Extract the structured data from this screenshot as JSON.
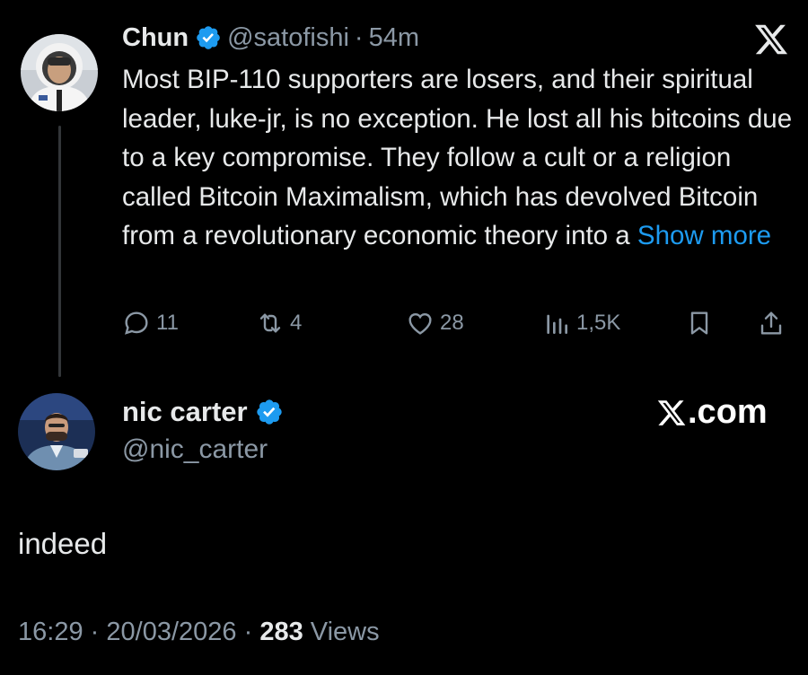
{
  "quoted_tweet": {
    "display_name": "Chun",
    "handle": "@satofishi",
    "separator": "·",
    "time": "54m",
    "text": "Most BIP-110 supporters are losers, and their spiritual leader, luke-jr, is no exception. He lost all his bitcoins due to a key compromise. They follow a cult or a religion called Bitcoin Maximalism, which has devolved Bitcoin from a revolutionary economic theory into a ",
    "show_more": "Show more",
    "actions": {
      "replies": "11",
      "reposts": "4",
      "likes": "28",
      "views": "1,5K"
    }
  },
  "reply_tweet": {
    "display_name": "nic carter",
    "handle": "@nic_carter",
    "text": "indeed",
    "time": "16:29",
    "date": "20/03/2026",
    "views_count": "283",
    "views_label": "Views",
    "separator": "·"
  },
  "watermark": {
    "suffix": ".com"
  },
  "colors": {
    "background": "#000000",
    "text_primary": "#e7e9ea",
    "text_secondary": "#8b98a5",
    "link_blue": "#1d9bf0",
    "verified_blue": "#1d9bf0"
  },
  "icons": [
    "x-logo-icon",
    "verified-badge-icon",
    "reply-icon",
    "repost-icon",
    "like-icon",
    "views-icon",
    "bookmark-icon",
    "share-icon"
  ]
}
